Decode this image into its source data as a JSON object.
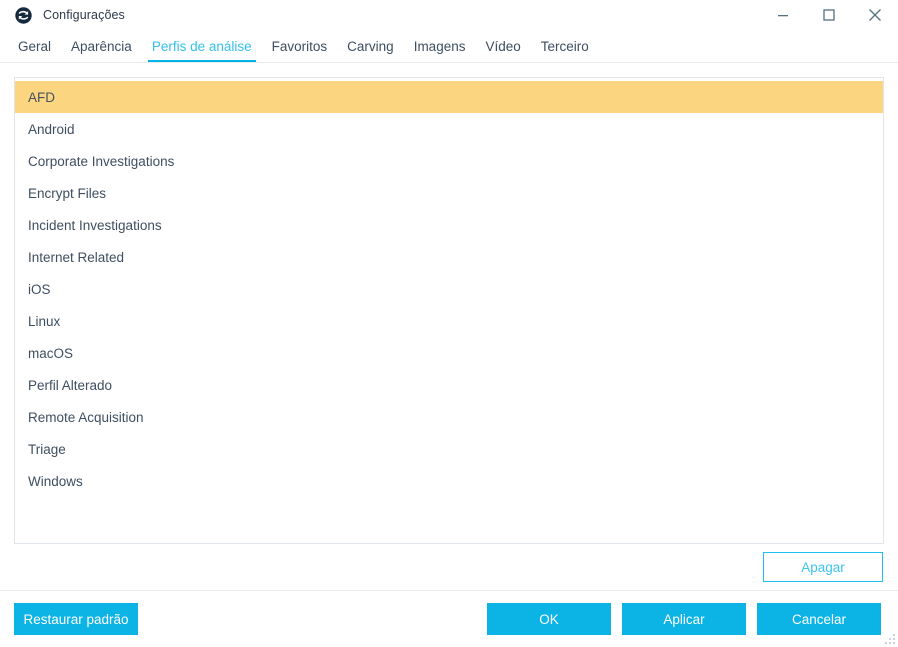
{
  "window": {
    "title": "Configurações",
    "logo_icon": "app-logo-icon",
    "controls": [
      {
        "name": "minimize",
        "icon": "minimize-icon"
      },
      {
        "name": "maximize",
        "icon": "maximize-icon"
      },
      {
        "name": "close",
        "icon": "close-icon"
      }
    ]
  },
  "tabs": [
    {
      "label": "Geral",
      "active": false
    },
    {
      "label": "Aparência",
      "active": false
    },
    {
      "label": "Perfis de análise",
      "active": true
    },
    {
      "label": "Favoritos",
      "active": false
    },
    {
      "label": "Carving",
      "active": false
    },
    {
      "label": "Imagens",
      "active": false
    },
    {
      "label": "Vídeo",
      "active": false
    },
    {
      "label": "Terceiro",
      "active": false
    }
  ],
  "profiles": {
    "selected_index": 0,
    "items": [
      {
        "label": "AFD"
      },
      {
        "label": "Android"
      },
      {
        "label": "Corporate Investigations"
      },
      {
        "label": "Encrypt Files"
      },
      {
        "label": "Incident Investigations"
      },
      {
        "label": "Internet Related"
      },
      {
        "label": "iOS"
      },
      {
        "label": "Linux"
      },
      {
        "label": "macOS"
      },
      {
        "label": "Perfil Alterado"
      },
      {
        "label": "Remote Acquisition"
      },
      {
        "label": "Triage"
      },
      {
        "label": "Windows"
      }
    ]
  },
  "actions": {
    "delete_label": "Apagar",
    "restore_label": "Restaurar padrão",
    "ok_label": "OK",
    "apply_label": "Aplicar",
    "cancel_label": "Cancelar"
  },
  "colors": {
    "accent": "#0cb4e6",
    "accent_tab": "#34c0eb",
    "selection": "#fcd581",
    "text": "#3d4f61",
    "border": "#dfe5ea"
  }
}
